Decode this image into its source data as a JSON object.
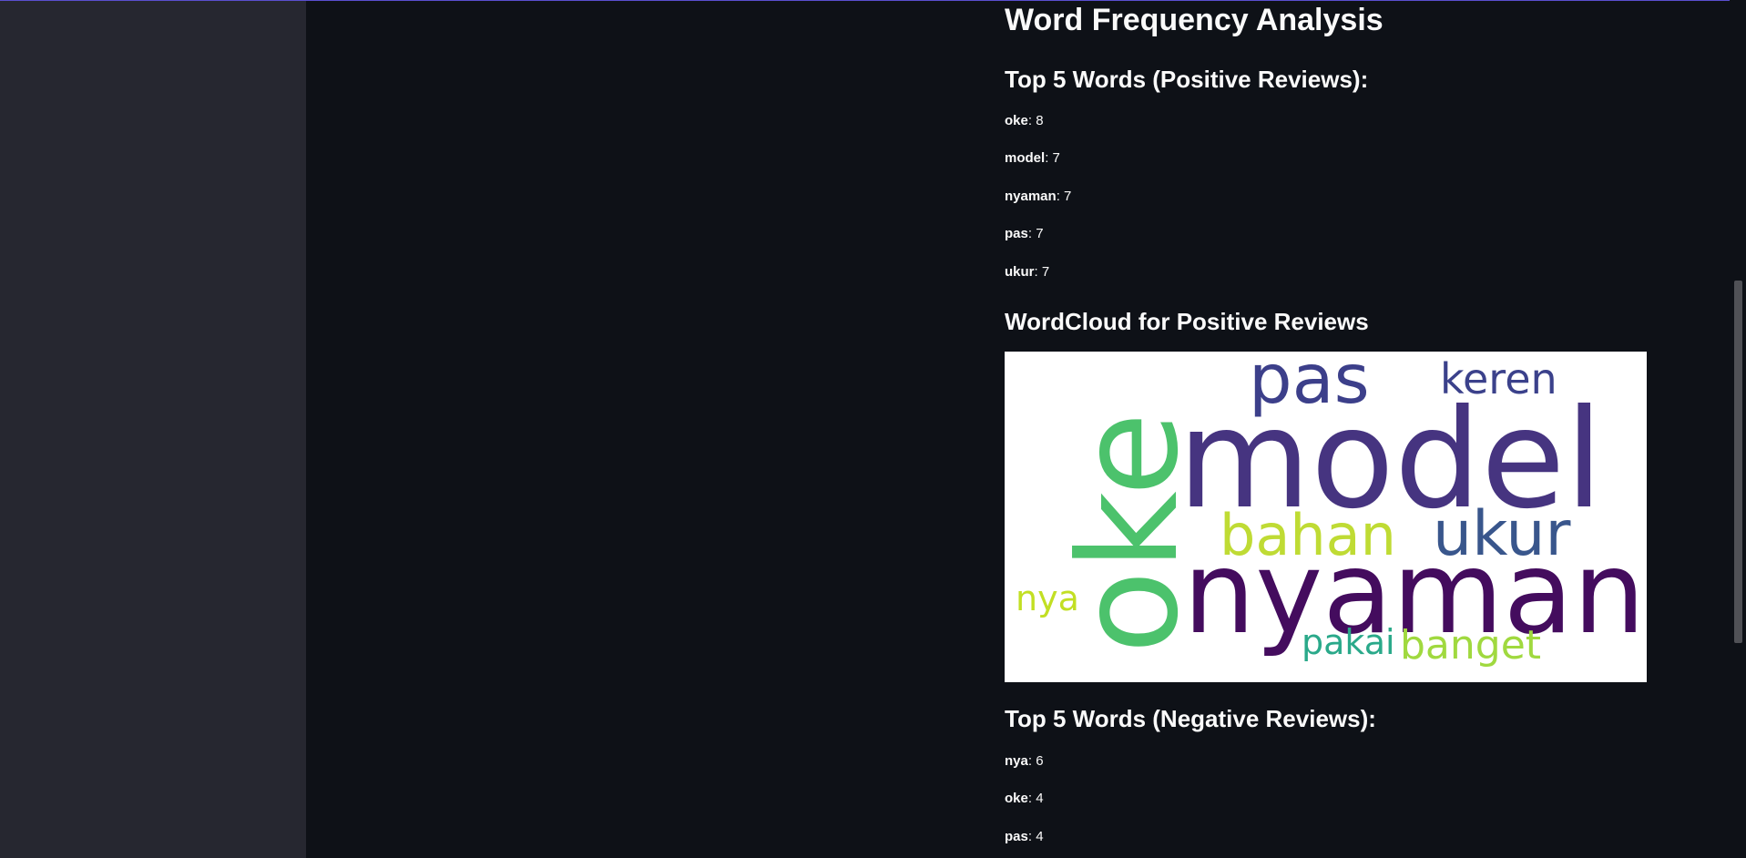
{
  "page": {
    "title": "Word Frequency Analysis",
    "positive_heading": "Top 5 Words (Positive Reviews):",
    "positive_words": [
      {
        "word": "oke",
        "count": "8"
      },
      {
        "word": "model",
        "count": "7"
      },
      {
        "word": "nyaman",
        "count": "7"
      },
      {
        "word": "pas",
        "count": "7"
      },
      {
        "word": "ukur",
        "count": "7"
      }
    ],
    "wordcloud_heading": "WordCloud for Positive Reviews",
    "wordcloud_words": [
      {
        "text": "model",
        "color": "#463480"
      },
      {
        "text": "nyaman",
        "color": "#440c5e"
      },
      {
        "text": "oke",
        "color": "#4cc26c"
      },
      {
        "text": "pas",
        "color": "#3c3f8a"
      },
      {
        "text": "keren",
        "color": "#3b418b"
      },
      {
        "text": "bahan",
        "color": "#bfdb34"
      },
      {
        "text": "ukur",
        "color": "#39568c"
      },
      {
        "text": "nya",
        "color": "#c2df23"
      },
      {
        "text": "pakai",
        "color": "#2aa98a"
      },
      {
        "text": "banget",
        "color": "#a0d93f"
      }
    ],
    "negative_heading": "Top 5 Words (Negative Reviews):",
    "negative_words": [
      {
        "word": "nya",
        "count": "6"
      },
      {
        "word": "oke",
        "count": "4"
      },
      {
        "word": "pas",
        "count": "4"
      }
    ]
  },
  "colors": {
    "background": "#0e1117",
    "sidebar": "#262730",
    "text": "#fafafa"
  }
}
